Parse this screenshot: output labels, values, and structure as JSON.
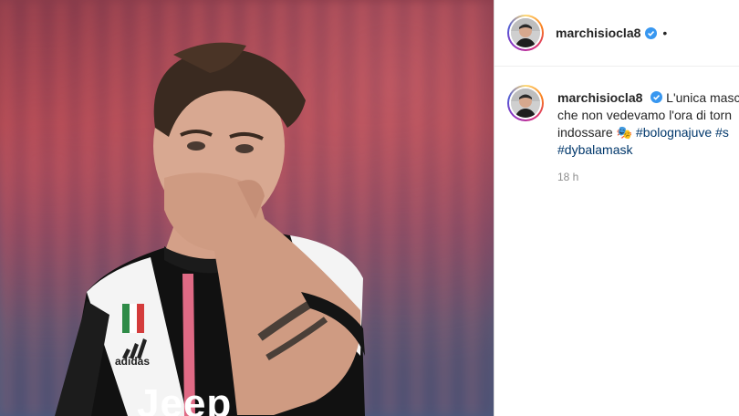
{
  "post": {
    "username": "marchisiocla8",
    "separator": "•",
    "caption": {
      "line1": "L'unica masc",
      "line2": "che non vedevamo l'ora di torn",
      "line3_text": "indossare",
      "emoji": "🎭",
      "hashtag1": "#bolognajuve",
      "hashtag2_fragment": "#s",
      "hashtag3": "#dybalamask"
    },
    "timestamp": "18 h"
  },
  "photo": {
    "sponsor_text": "Jeep",
    "brand_text": "adidas"
  },
  "colors": {
    "link": "#00376b",
    "verified": "#3897f0",
    "text": "#262626",
    "muted": "#8e8e8e"
  }
}
